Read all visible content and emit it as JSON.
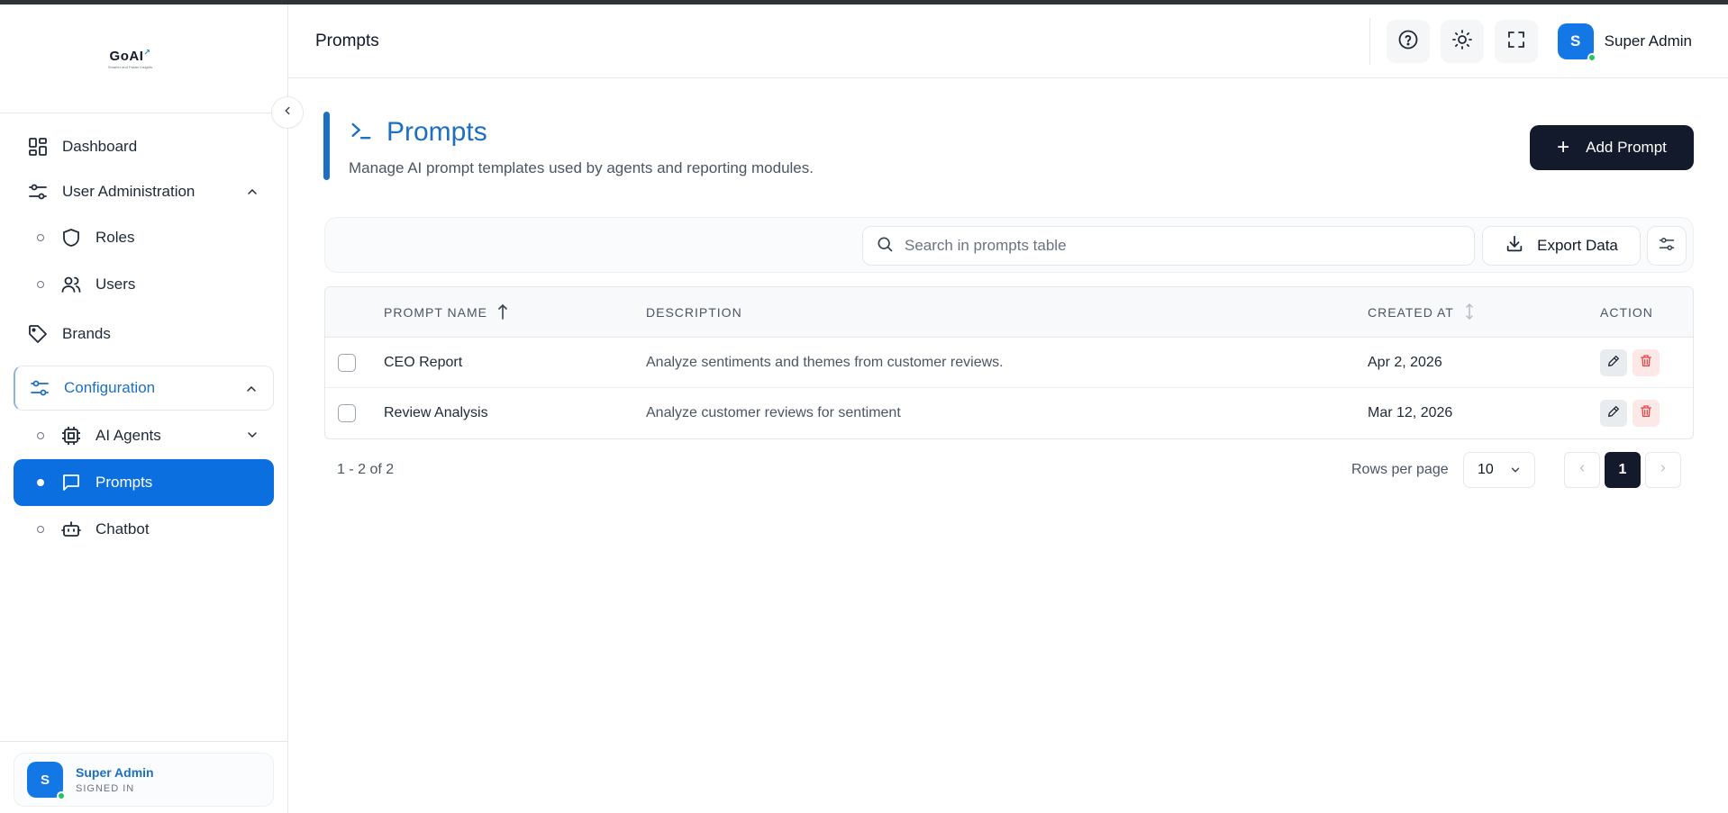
{
  "brand": {
    "logo_text": "GoAI",
    "tagline": "Smarter and Faster Insights"
  },
  "header": {
    "title": "Prompts",
    "user_name": "Super Admin",
    "avatar_initial": "S"
  },
  "sidebar": {
    "items": [
      {
        "label": "Dashboard",
        "icon": "dashboard-icon"
      },
      {
        "label": "User Administration",
        "icon": "sliders-icon"
      },
      {
        "label": "Roles",
        "icon": "shield-icon"
      },
      {
        "label": "Users",
        "icon": "users-icon"
      },
      {
        "label": "Brands",
        "icon": "tag-icon"
      },
      {
        "label": "Configuration",
        "icon": "sliders-icon"
      },
      {
        "label": "AI Agents",
        "icon": "cpu-icon"
      },
      {
        "label": "Prompts",
        "icon": "message-square-icon"
      },
      {
        "label": "Chatbot",
        "icon": "bot-icon"
      }
    ],
    "user": {
      "name": "Super Admin",
      "status": "SIGNED IN",
      "initial": "S"
    }
  },
  "page": {
    "title": "Prompts",
    "description": "Manage AI prompt templates used by agents and reporting modules.",
    "add_button": "Add Prompt"
  },
  "toolbar": {
    "search_placeholder": "Search in prompts table",
    "export_label": "Export Data"
  },
  "table": {
    "columns": [
      "PROMPT NAME",
      "DESCRIPTION",
      "CREATED AT",
      "ACTION"
    ],
    "rows": [
      {
        "name": "CEO Report",
        "description": "Analyze sentiments and themes from customer reviews.",
        "created_at": "Apr 2, 2026"
      },
      {
        "name": "Review Analysis",
        "description": "Analyze customer reviews for sentiment",
        "created_at": "Mar 12, 2026"
      }
    ]
  },
  "pagination": {
    "range_text": "1 - 2 of 2",
    "rows_per_page_label": "Rows per page",
    "rows_per_page": "10",
    "current_page": "1"
  },
  "colors": {
    "accent": "#1d6fbf",
    "active_nav": "#0b6fe0",
    "dark_button": "#131a2b",
    "online": "#22c55e"
  }
}
